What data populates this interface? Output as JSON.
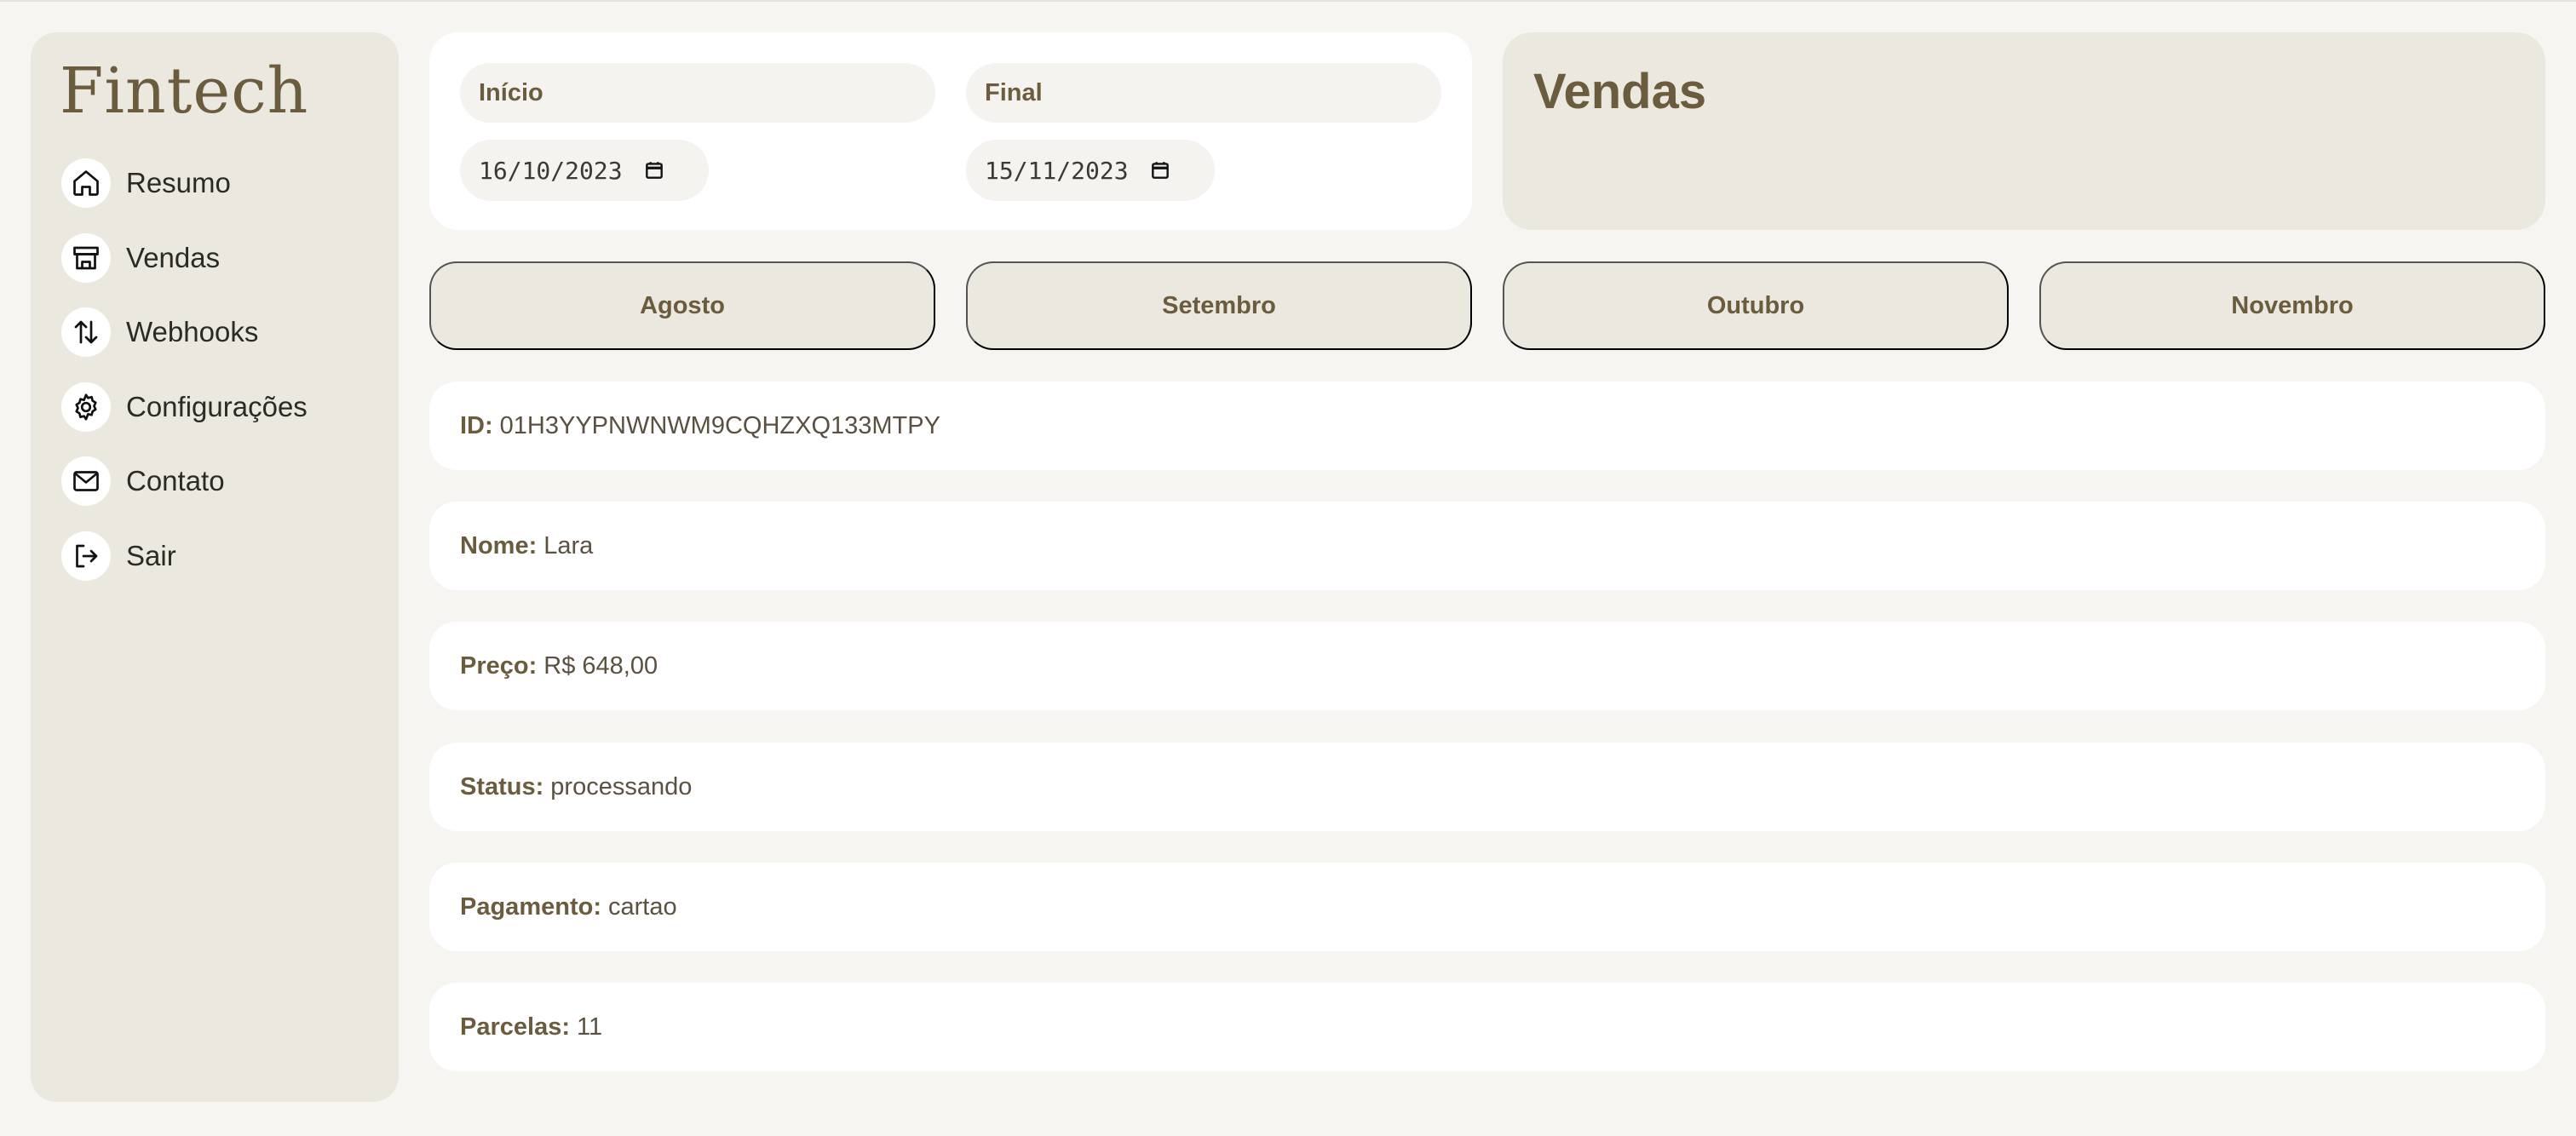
{
  "sidebar": {
    "logo": "Fintech",
    "items": [
      {
        "label": "Resumo",
        "icon": "home-icon"
      },
      {
        "label": "Vendas",
        "icon": "store-icon"
      },
      {
        "label": "Webhooks",
        "icon": "arrows-up-down-icon"
      },
      {
        "label": "Configurações",
        "icon": "gear-icon"
      },
      {
        "label": "Contato",
        "icon": "mail-icon"
      },
      {
        "label": "Sair",
        "icon": "logout-icon"
      }
    ]
  },
  "date_filter": {
    "start_label": "Início",
    "start_value": "16/10/2023",
    "end_label": "Final",
    "end_value": "15/11/2023"
  },
  "page_title": "Vendas",
  "months": [
    "Agosto",
    "Setembro",
    "Outubro",
    "Novembro"
  ],
  "sale": {
    "id": {
      "label": "ID:",
      "value": "01H3YYPNWNWM9CQHZXQ133MTPY"
    },
    "nome": {
      "label": "Nome:",
      "value": "Lara"
    },
    "preco": {
      "label": "Preço:",
      "value": "R$ 648,00"
    },
    "status": {
      "label": "Status:",
      "value": "processando"
    },
    "pagamento": {
      "label": "Pagamento:",
      "value": "cartao"
    },
    "parcelas": {
      "label": "Parcelas:",
      "value": "11"
    }
  },
  "colors": {
    "accent": "#6b5c3e",
    "panel": "#ebe9df",
    "background": "#f6f5f2",
    "card": "#ffffff"
  }
}
